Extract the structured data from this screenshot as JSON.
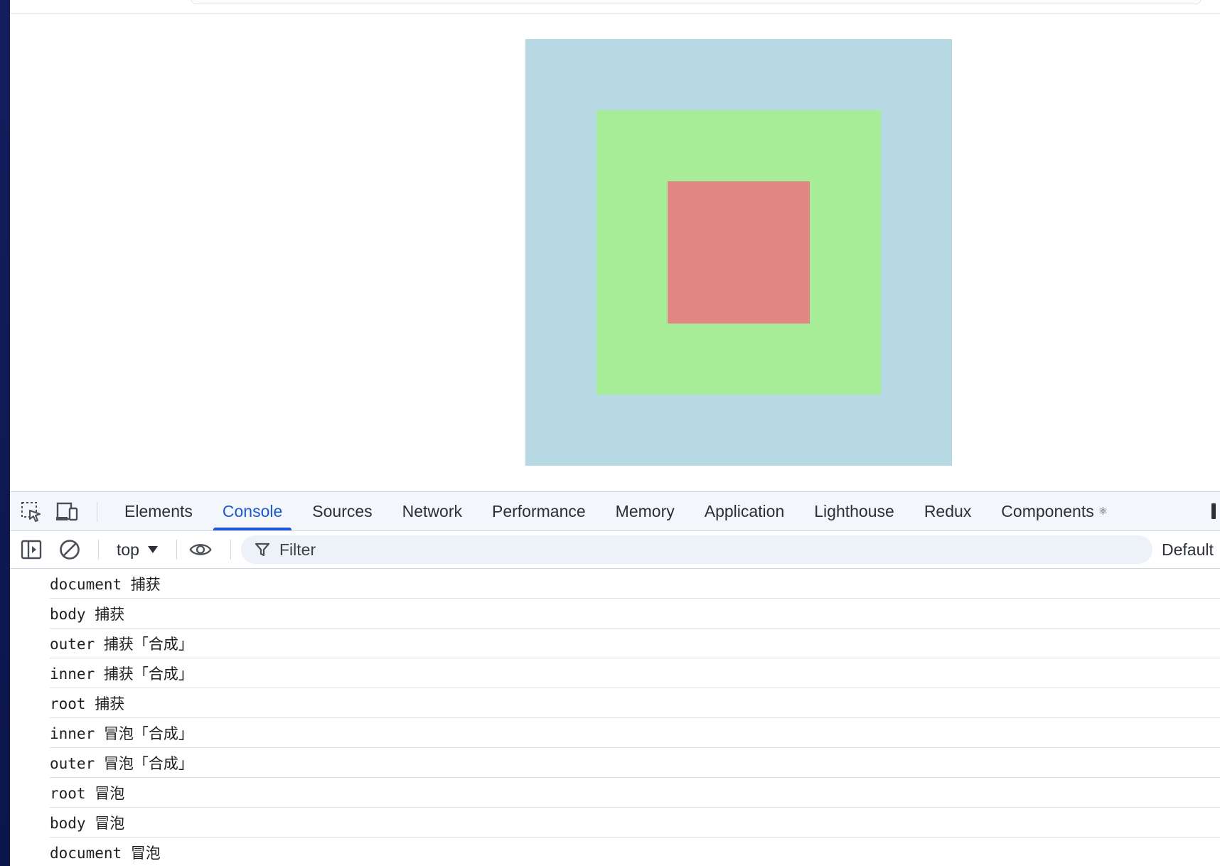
{
  "colors": {
    "root_box": "#b6d9e3",
    "outer_box": "#a7ec97",
    "inner_box": "#e18683",
    "active_tab": "#1a58d6"
  },
  "devtools": {
    "tool_icons": [
      "inspect-element-icon",
      "device-toolbar-icon"
    ],
    "tabs": [
      {
        "label": "Elements",
        "active": false
      },
      {
        "label": "Console",
        "active": true
      },
      {
        "label": "Sources",
        "active": false
      },
      {
        "label": "Network",
        "active": false
      },
      {
        "label": "Performance",
        "active": false
      },
      {
        "label": "Memory",
        "active": false
      },
      {
        "label": "Application",
        "active": false
      },
      {
        "label": "Lighthouse",
        "active": false
      },
      {
        "label": "Redux",
        "active": false
      },
      {
        "label": "Components",
        "active": false
      }
    ],
    "components_glyph": "⚛"
  },
  "console_toolbar": {
    "context": "top",
    "filter_placeholder": "Filter",
    "levels_label": "Default"
  },
  "console_logs": [
    "document 捕获",
    "body 捕获",
    "outer 捕获「合成」",
    "inner 捕获「合成」",
    "root 捕获",
    "inner 冒泡「合成」",
    "outer 冒泡「合成」",
    "root 冒泡",
    "body 冒泡",
    "document 冒泡"
  ]
}
